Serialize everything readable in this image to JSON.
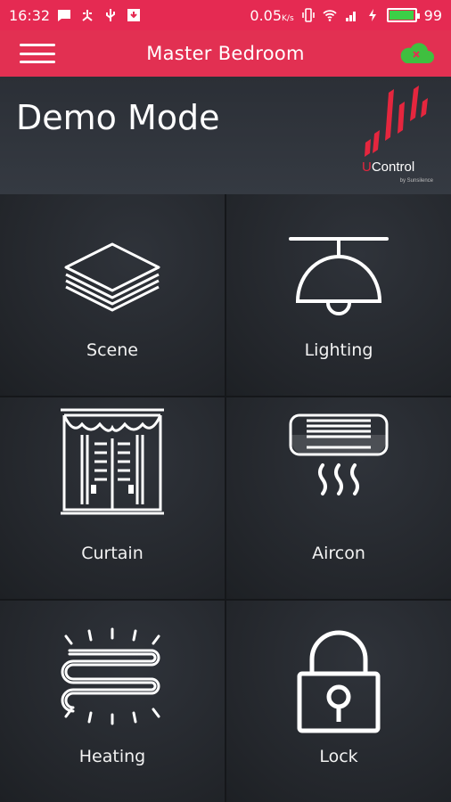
{
  "status_bar": {
    "time": "16:32",
    "data_rate": "0.05",
    "data_unit": "K/s",
    "battery_level": "99",
    "battery_fraction": 0.99,
    "icons": [
      "message-icon",
      "usb-share-icon",
      "usb-icon",
      "download-icon",
      "vibrate-icon",
      "wifi-icon",
      "signal-icon",
      "charging-icon",
      "battery-icon"
    ]
  },
  "app_bar": {
    "title": "Master Bedroom",
    "menu_icon": "hamburger-menu-icon",
    "cloud_icon": "cloud-disconnected-icon",
    "cloud_color": "#3fbf3f"
  },
  "header": {
    "mode_label": "Demo Mode",
    "logo": {
      "brand_prefix": "U",
      "brand_rest": "Control",
      "tagline": "by Sunsilence"
    }
  },
  "tiles": [
    {
      "label": "Scene",
      "icon": "layers-icon"
    },
    {
      "label": "Lighting",
      "icon": "ceiling-lamp-icon"
    },
    {
      "label": "Curtain",
      "icon": "curtain-icon"
    },
    {
      "label": "Aircon",
      "icon": "air-conditioner-icon"
    },
    {
      "label": "Heating",
      "icon": "heating-icon"
    },
    {
      "label": "Lock",
      "icon": "padlock-icon"
    }
  ],
  "colors": {
    "accent": "#e23052",
    "status_bar": "#e52a52",
    "brand_red": "#e5263e",
    "tile_bg": "#23262b"
  }
}
